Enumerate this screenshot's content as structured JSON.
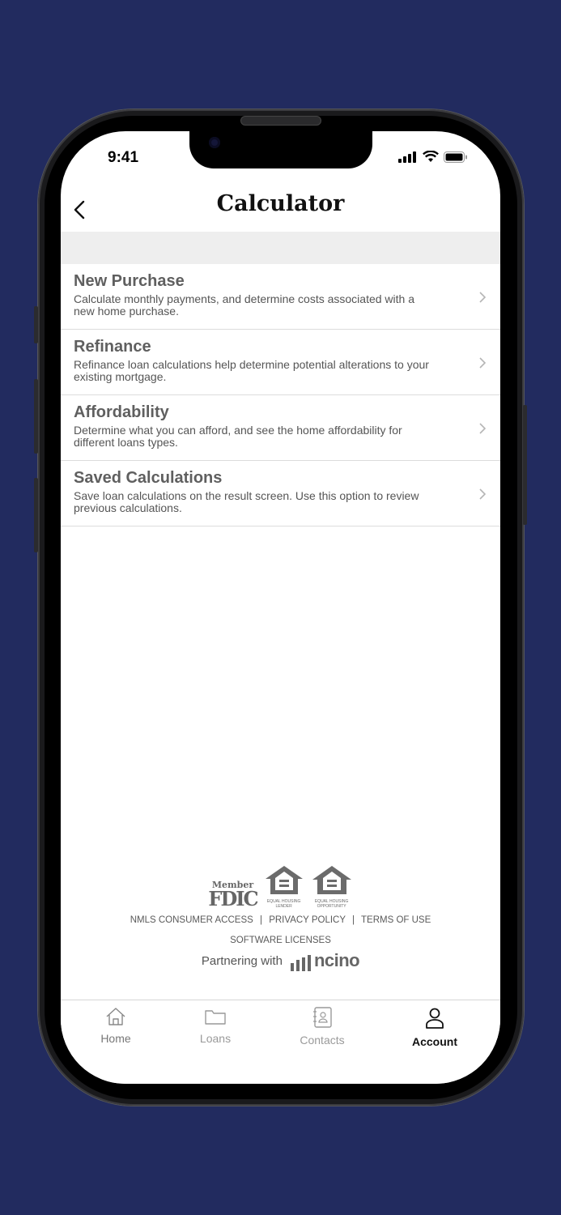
{
  "status_bar": {
    "time": "9:41"
  },
  "header": {
    "title": "Calculator"
  },
  "list": [
    {
      "title": "New Purchase",
      "description": "Calculate monthly payments, and determine costs associated with a new home purchase."
    },
    {
      "title": "Refinance",
      "description": "Refinance loan calculations help determine potential alterations to your existing mortgage."
    },
    {
      "title": "Affordability",
      "description": "Determine what you can afford, and see the home affordability for different loans types."
    },
    {
      "title": "Saved Calculations",
      "description": "Save loan calculations on the result screen. Use this option to review previous calculations."
    }
  ],
  "footer": {
    "logos": {
      "fdic_member": "Member",
      "fdic": "FDIC",
      "equal_housing_lender": "EQUAL HOUSING LENDER",
      "equal_housing_opportunity": "EQUAL HOUSING OPPORTUNITY"
    },
    "links": [
      "NMLS CONSUMER ACCESS",
      "PRIVACY POLICY",
      "TERMS OF USE"
    ],
    "separator": "|",
    "software_licenses": "SOFTWARE LICENSES",
    "partnering_with": "Partnering with",
    "partner_brand": "ncino"
  },
  "tabbar": {
    "tabs": [
      {
        "label": "Home",
        "icon": "home-icon"
      },
      {
        "label": "Loans",
        "icon": "folder-icon"
      },
      {
        "label": "Contacts",
        "icon": "contacts-icon"
      },
      {
        "label": "Account",
        "icon": "person-icon",
        "active": true
      }
    ]
  },
  "colors": {
    "background": "#222b5f",
    "accent": "#111111"
  }
}
